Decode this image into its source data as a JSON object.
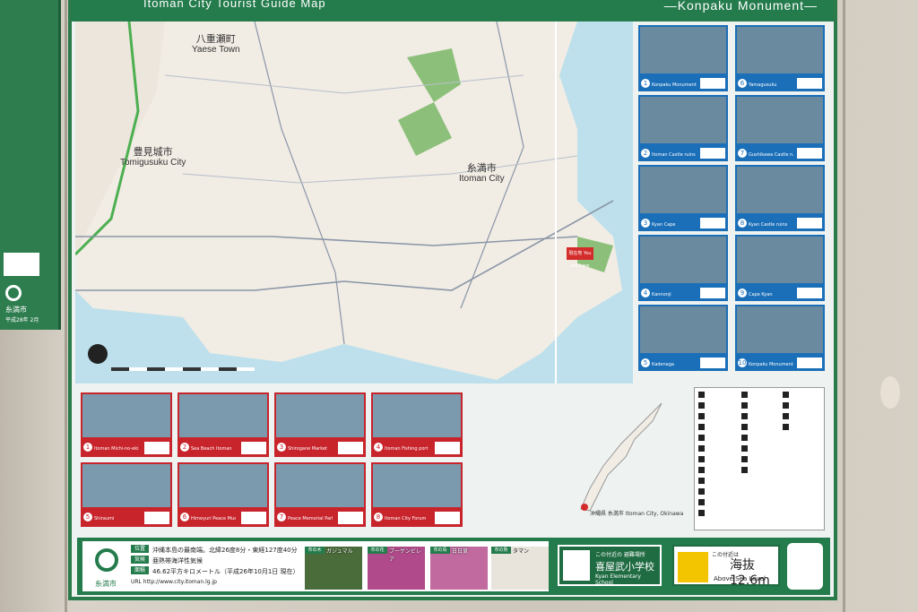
{
  "board": {
    "title": "Itoman City Tourist Guide Map",
    "subtitle": "—Konpaku Monument—"
  },
  "sidepanel": {
    "city": "糸満市",
    "year": "平成28年 2月"
  },
  "map": {
    "labels": [
      {
        "jp": "八重瀬町",
        "en": "Yaese Town"
      },
      {
        "jp": "豊見城市",
        "en": "Tomigusuku City"
      },
      {
        "jp": "糸満市",
        "en": "Itoman City"
      }
    ],
    "you_are_here": "現在地 You are here"
  },
  "right_cards": [
    {
      "num": "1",
      "caption": "Konpaku Monument"
    },
    {
      "num": "6",
      "caption": "Yamagusuku"
    },
    {
      "num": "2",
      "caption": "Itoman Castle ruins"
    },
    {
      "num": "7",
      "caption": "Gushikawa Castle ruins"
    },
    {
      "num": "3",
      "caption": "Kyan Cape"
    },
    {
      "num": "8",
      "caption": "Kyan Castle ruins"
    },
    {
      "num": "4",
      "caption": "Kannonji"
    },
    {
      "num": "9",
      "caption": "Cape Kyan"
    },
    {
      "num": "5",
      "caption": "Kadenaga"
    },
    {
      "num": "10",
      "caption": "Konpaku Monument"
    }
  ],
  "bottom_cards": [
    {
      "num": "1",
      "caption": "Itoman Michi-no-eki"
    },
    {
      "num": "2",
      "caption": "Sea Beach Itoman"
    },
    {
      "num": "3",
      "caption": "Shirogane Market"
    },
    {
      "num": "4",
      "caption": "Itoman Fishing port"
    },
    {
      "num": "5",
      "caption": "Shiraumi"
    },
    {
      "num": "6",
      "caption": "Himeyuri Peace Museum"
    },
    {
      "num": "7",
      "caption": "Peace Memorial Park"
    },
    {
      "num": "8",
      "caption": "Itoman City Forum"
    }
  ],
  "okinawa_label": "沖縄県 糸満市 Itoman City, Okinawa",
  "footer": {
    "city": "糸満市",
    "tags": [
      "位置",
      "気候",
      "面積"
    ],
    "lines": [
      "沖縄本島の最南端。北緯26度8分・東経127度40分",
      "亜熱帯海洋性気候",
      "46.62平方キロメートル（平成26年10月1日 現在）"
    ],
    "url": "URL http://www.city.itoman.lg.jp",
    "images": [
      {
        "cat": "市の木",
        "name": "ガジュマル"
      },
      {
        "cat": "市の花",
        "name": "ブーゲンビレア"
      },
      {
        "cat": "市の鳥",
        "name": "日日草"
      },
      {
        "cat": "市の魚",
        "name": "タマン"
      }
    ],
    "evac": {
      "a": "この付近の 避難場所",
      "b": "喜屋武小学校",
      "c": "Kyan Elementary School"
    },
    "sea": {
      "a": "この付近は",
      "b": "海抜 12.6m",
      "c": "Above Sea Level"
    }
  }
}
